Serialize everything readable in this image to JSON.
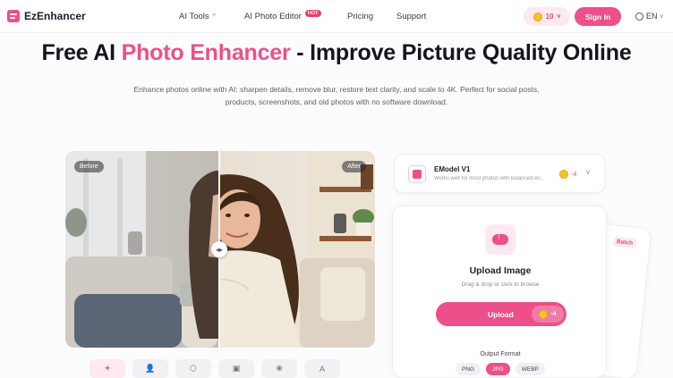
{
  "nav": {
    "logo_text": "EzEnhancer",
    "items": [
      {
        "label": "AI Tools",
        "caret": "^"
      },
      {
        "label": "AI Photo Editor",
        "badge": "HOT"
      },
      {
        "label": "Pricing"
      },
      {
        "label": "Support"
      }
    ],
    "credits": "10",
    "credits_caret": "v",
    "signin_label": "Sign In",
    "language": "EN",
    "language_caret": "v"
  },
  "hero": {
    "title_start": "Free AI ",
    "title_accent": "Photo Enhancer",
    "title_end": " - Improve Picture Quality Online",
    "description": "Enhance photos online with AI: sharpen details, remove blur, restore text clarity, and scale to 4K. Perfect for social posts, products, screenshots, and old photos with no software download."
  },
  "compare": {
    "before_label": "Before",
    "after_label": "After",
    "handle": "◂▸"
  },
  "tools": [
    {
      "icon": "magic-wand-icon",
      "glyph": "✦"
    },
    {
      "icon": "person-icon",
      "glyph": "👤"
    },
    {
      "icon": "box-icon",
      "glyph": "⬡"
    },
    {
      "icon": "image-icon",
      "glyph": "▣"
    },
    {
      "icon": "paw-icon",
      "glyph": "❀"
    },
    {
      "icon": "text-icon",
      "glyph": "A"
    }
  ],
  "model": {
    "name": "EModel V1",
    "description": "Works well for most photos with balanced en...",
    "cost": "-4",
    "caret": "v"
  },
  "upload": {
    "title": "Upload Image",
    "hint": "Drag & drop or click to browse",
    "button_label": "Upload",
    "button_cost": "-4",
    "output_format_label": "Output Format",
    "formats": [
      "PNG",
      "JPG",
      "WEBP"
    ],
    "selected_format": "JPG"
  },
  "batch": {
    "label": "Batch"
  },
  "colors": {
    "accent": "#ec4f8a",
    "accent_soft": "#fde9ef",
    "hot": "#ef3e6b"
  }
}
